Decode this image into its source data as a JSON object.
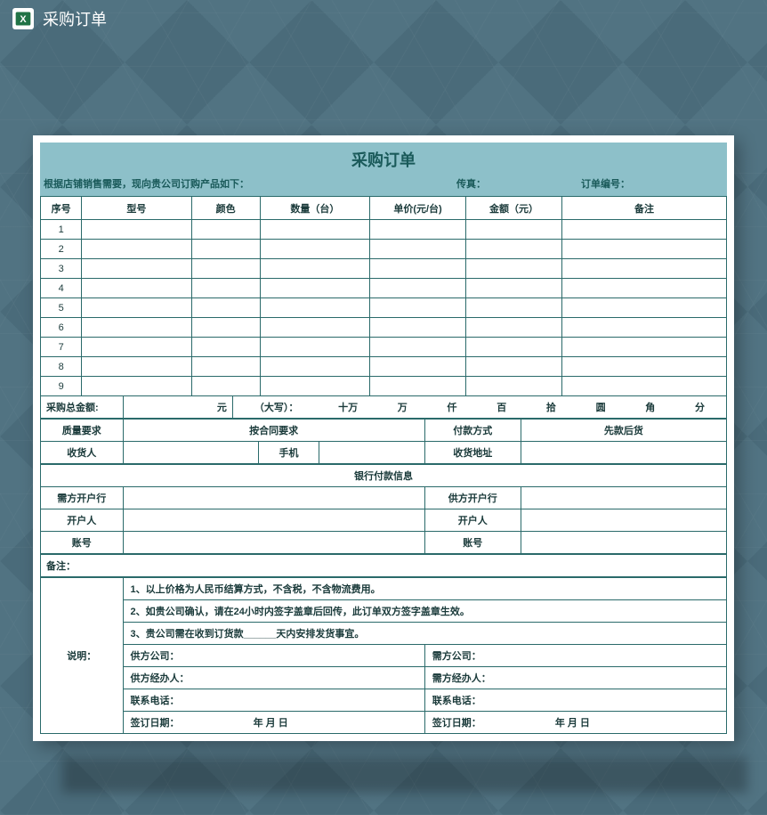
{
  "header": {
    "title": "采购订单"
  },
  "document": {
    "title": "采购订单",
    "intro": "根据店铺销售需要，现向贵公司订购产品如下：",
    "fax_label": "传真：",
    "order_no_label": "订单编号："
  },
  "table": {
    "headers": {
      "seq": "序号",
      "model": "型号",
      "color": "颜色",
      "quantity": "数量（台）",
      "unit_price": "单价(元/台)",
      "amount": "金额（元）",
      "remark": "备注"
    },
    "rows": [
      {
        "seq": "1",
        "model": "",
        "color": "",
        "quantity": "",
        "unit_price": "",
        "amount": "",
        "remark": ""
      },
      {
        "seq": "2",
        "model": "",
        "color": "",
        "quantity": "",
        "unit_price": "",
        "amount": "",
        "remark": ""
      },
      {
        "seq": "3",
        "model": "",
        "color": "",
        "quantity": "",
        "unit_price": "",
        "amount": "",
        "remark": ""
      },
      {
        "seq": "4",
        "model": "",
        "color": "",
        "quantity": "",
        "unit_price": "",
        "amount": "",
        "remark": ""
      },
      {
        "seq": "5",
        "model": "",
        "color": "",
        "quantity": "",
        "unit_price": "",
        "amount": "",
        "remark": ""
      },
      {
        "seq": "6",
        "model": "",
        "color": "",
        "quantity": "",
        "unit_price": "",
        "amount": "",
        "remark": ""
      },
      {
        "seq": "7",
        "model": "",
        "color": "",
        "quantity": "",
        "unit_price": "",
        "amount": "",
        "remark": ""
      },
      {
        "seq": "8",
        "model": "",
        "color": "",
        "quantity": "",
        "unit_price": "",
        "amount": "",
        "remark": ""
      },
      {
        "seq": "9",
        "model": "",
        "color": "",
        "quantity": "",
        "unit_price": "",
        "amount": "",
        "remark": ""
      }
    ]
  },
  "totals": {
    "label": "采购总金额:",
    "yuan": "元",
    "caps_label": "（大写）：",
    "units": {
      "shiwan": "十万",
      "wan": "万",
      "qian": "仟",
      "bai": "百",
      "shi": "拾",
      "yuan2": "圆",
      "jiao": "角",
      "fen": "分"
    }
  },
  "quality": {
    "label": "质量要求",
    "value": "按合同要求",
    "pay_method_label": "付款方式",
    "pay_method_value": "先款后货"
  },
  "receiver": {
    "label": "收货人",
    "mobile_label": "手机",
    "addr_label": "收货地址"
  },
  "bank": {
    "section_title": "银行付款信息",
    "demand_bank": "需方开户行",
    "supply_bank": "供方开户行",
    "holder_label": "开户人",
    "account_label": "账号"
  },
  "remarks_label": "备注：",
  "description": {
    "label": "说明：",
    "line1": "1、以上价格为人民币结算方式，不含税，不含物流费用。",
    "line2": "2、如贵公司确认，请在24小时内签字盖章后回传，此订单双方签字盖章生效。",
    "line3": "3、贵公司需在收到订货款______天内安排发货事宜。",
    "supplier_company": "供方公司：",
    "demand_company": "需方公司：",
    "supplier_agent": "供方经办人：",
    "demand_agent": "需方经办人：",
    "supplier_phone": "联系电话：",
    "demand_phone": "联系电话：",
    "sign_date_label": "签订日期：",
    "date_fmt": "年      月     日"
  }
}
